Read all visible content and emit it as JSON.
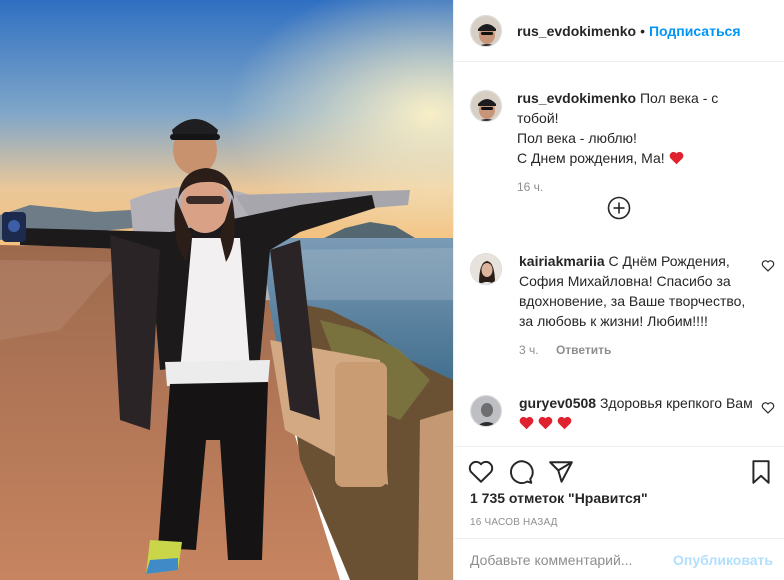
{
  "post": {
    "author": "rus_evdokimenko",
    "follow_label": "Подписаться",
    "separator": "•"
  },
  "caption": {
    "username": "rus_evdokimenko",
    "line1": "Пол века - с тобой!",
    "line2": "Пол века - люблю!",
    "line3": "С Днем рождения, Ма!",
    "time": "16 ч."
  },
  "comments": [
    {
      "username": "kairiakmariia",
      "text": "С Днём Рождения, София Михайловна! Спасибо за вдохновение, за Ваше творчество, за любовь к жизни! Любим!!!!",
      "time": "3 ч.",
      "reply_label": "Ответить"
    },
    {
      "username": "guryev0508",
      "text": "Здоровья крепкого Вам",
      "hearts": 3
    }
  ],
  "footer": {
    "likes": "1 735 отметок \"Нравится\"",
    "timestamp": "16 ЧАСОВ НАЗАД",
    "comment_placeholder": "Добавьте комментарий...",
    "publish_label": "Опубликовать"
  },
  "colors": {
    "link": "#0095f6",
    "heart": "#ed4956",
    "muted": "#8e8e8e",
    "publish_disabled": "#b2dffc"
  },
  "icons": [
    "plus-circle-icon",
    "heart-icon",
    "comment-icon",
    "share-icon",
    "bookmark-icon",
    "heart-emoji-icon"
  ]
}
